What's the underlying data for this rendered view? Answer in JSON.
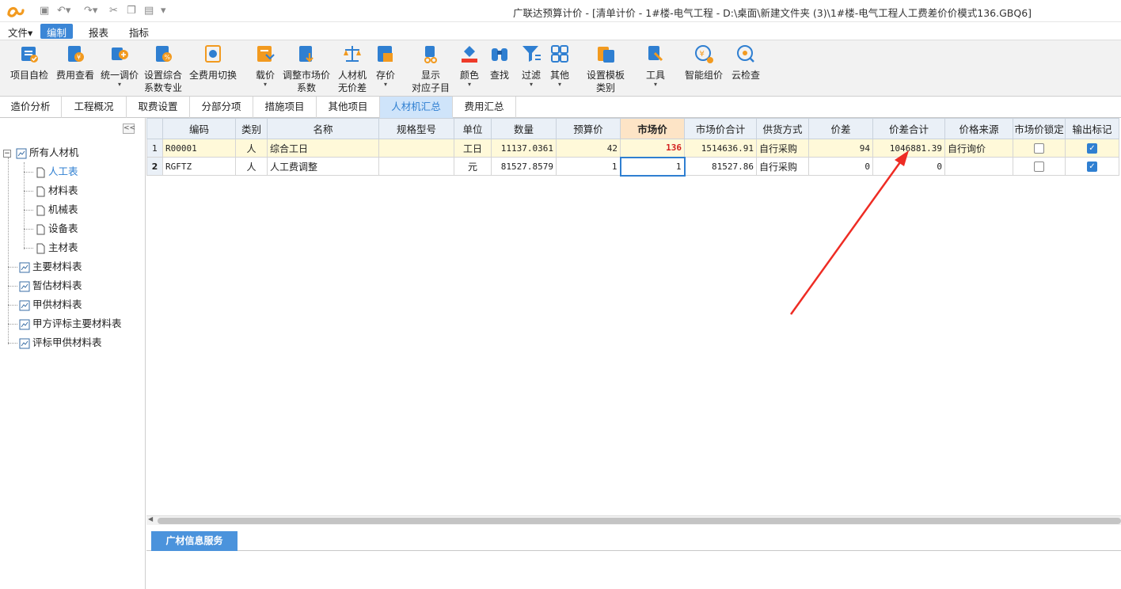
{
  "window": {
    "title": "广联达预算计价 - [清单计价 - 1#楼-电气工程 - D:\\桌面\\新建文件夹 (3)\\1#楼-电气工程人工费差价价模式136.GBQ6]"
  },
  "menu": [
    "文件▾",
    "编制",
    "报表",
    "指标"
  ],
  "ribbon": [
    {
      "l1": "项目自检",
      "l2": "",
      "icon": "check-icon"
    },
    {
      "l1": "费用查看",
      "l2": "",
      "icon": "fee-view-icon"
    },
    {
      "l1": "统一调价",
      "l2": "▾",
      "icon": "adjust-price-icon"
    },
    {
      "l1": "设置综合",
      "l2": "系数专业",
      "icon": "coefficient-icon"
    },
    {
      "l1": "全费用切换",
      "l2": "",
      "icon": "full-cost-icon"
    },
    {
      "l1": "载价",
      "l2": "▾",
      "icon": "load-price-icon"
    },
    {
      "l1": "调整市场价",
      "l2": "系数",
      "icon": "adjust-market-icon"
    },
    {
      "l1": "人材机",
      "l2": "无价差",
      "icon": "balance-icon"
    },
    {
      "l1": "存价",
      "l2": "▾",
      "icon": "save-price-icon"
    },
    {
      "l1": "显示",
      "l2": "对应子目",
      "icon": "show-items-icon"
    },
    {
      "l1": "颜色",
      "l2": "▾",
      "icon": "color-icon"
    },
    {
      "l1": "查找",
      "l2": "",
      "icon": "binoculars-icon"
    },
    {
      "l1": "过滤",
      "l2": "▾",
      "icon": "filter-icon"
    },
    {
      "l1": "其他",
      "l2": "▾",
      "icon": "grid-icon"
    },
    {
      "l1": "设置模板",
      "l2": "类别",
      "icon": "template-icon"
    },
    {
      "l1": "工具",
      "l2": "▾",
      "icon": "tool-icon"
    },
    {
      "l1": "智能组价",
      "l2": "",
      "icon": "smart-price-icon"
    },
    {
      "l1": "云检查",
      "l2": "",
      "icon": "cloud-check-icon"
    }
  ],
  "tabs": [
    "造价分析",
    "工程概况",
    "取费设置",
    "分部分项",
    "措施项目",
    "其他项目",
    "人材机汇总",
    "费用汇总"
  ],
  "active_tab": "人材机汇总",
  "tree": {
    "root": "所有人材机",
    "children": [
      "人工表",
      "材料表",
      "机械表",
      "设备表",
      "主材表"
    ],
    "selected": "人工表",
    "others": [
      "主要材料表",
      "暂估材料表",
      "甲供材料表",
      "甲方评标主要材料表",
      "评标甲供材料表"
    ]
  },
  "columns": [
    "编码",
    "类别",
    "名称",
    "规格型号",
    "单位",
    "数量",
    "预算价",
    "市场价",
    "市场价合计",
    "供货方式",
    "价差",
    "价差合计",
    "价格来源",
    "市场价锁定",
    "输出标记"
  ],
  "rows": [
    {
      "no": "1",
      "code": "R00001",
      "type": "人",
      "name": "综合工日",
      "spec": "",
      "unit": "工日",
      "qty": "11137.0361",
      "budget": "42",
      "market": "136",
      "market_total": "1514636.91",
      "supply": "自行采购",
      "diff": "94",
      "diff_total": "1046881.39",
      "source": "自行询价",
      "lock": false,
      "output": true
    },
    {
      "no": "2",
      "code": "RGFTZ",
      "type": "人",
      "name": "人工费调整",
      "spec": "",
      "unit": "元",
      "qty": "81527.8579",
      "budget": "1",
      "market": "1",
      "market_total": "81527.86",
      "supply": "自行采购",
      "diff": "0",
      "diff_total": "0",
      "source": "",
      "lock": false,
      "output": true
    }
  ],
  "bottom_tab": "广材信息服务",
  "colors": {
    "accent": "#3b86d6",
    "arrow": "#ee2c24",
    "highlight_row": "#fff9d9",
    "market_price": "#d21f1f"
  }
}
